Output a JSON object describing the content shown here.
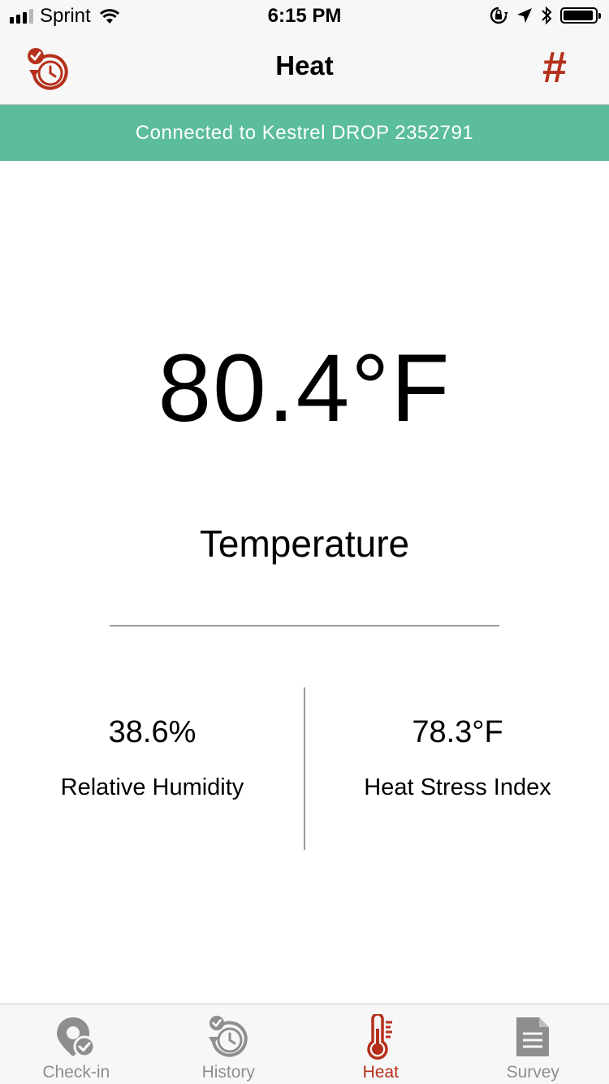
{
  "status_bar": {
    "carrier": "Sprint",
    "time": "6:15 PM",
    "signal_bars_active": 3,
    "signal_bars_total": 4,
    "battery_level": 0.95,
    "icons": [
      "wifi-icon",
      "orientation-lock-icon",
      "location-icon",
      "bluetooth-icon",
      "battery-icon"
    ]
  },
  "nav": {
    "title": "Heat",
    "left_icon": "history-clock-check-icon",
    "right_text": "#"
  },
  "banner": {
    "text": "Connected to Kestrel DROP 2352791"
  },
  "reading": {
    "value": "80.4°F",
    "label": "Temperature"
  },
  "stats": [
    {
      "value": "38.6%",
      "label": "Relative Humidity"
    },
    {
      "value": "78.3°F",
      "label": "Heat Stress Index"
    }
  ],
  "tabs": [
    {
      "label": "Check-in",
      "icon": "check-in-pin-icon",
      "active": false
    },
    {
      "label": "History",
      "icon": "history-clock-icon",
      "active": false
    },
    {
      "label": "Heat",
      "icon": "thermometer-icon",
      "active": true
    },
    {
      "label": "Survey",
      "icon": "survey-document-icon",
      "active": false
    }
  ],
  "colors": {
    "accent": "#b5301b",
    "banner": "#5bbd9d",
    "inactive_tab": "#8e8e8e",
    "bar_background": "#f7f7f7"
  }
}
